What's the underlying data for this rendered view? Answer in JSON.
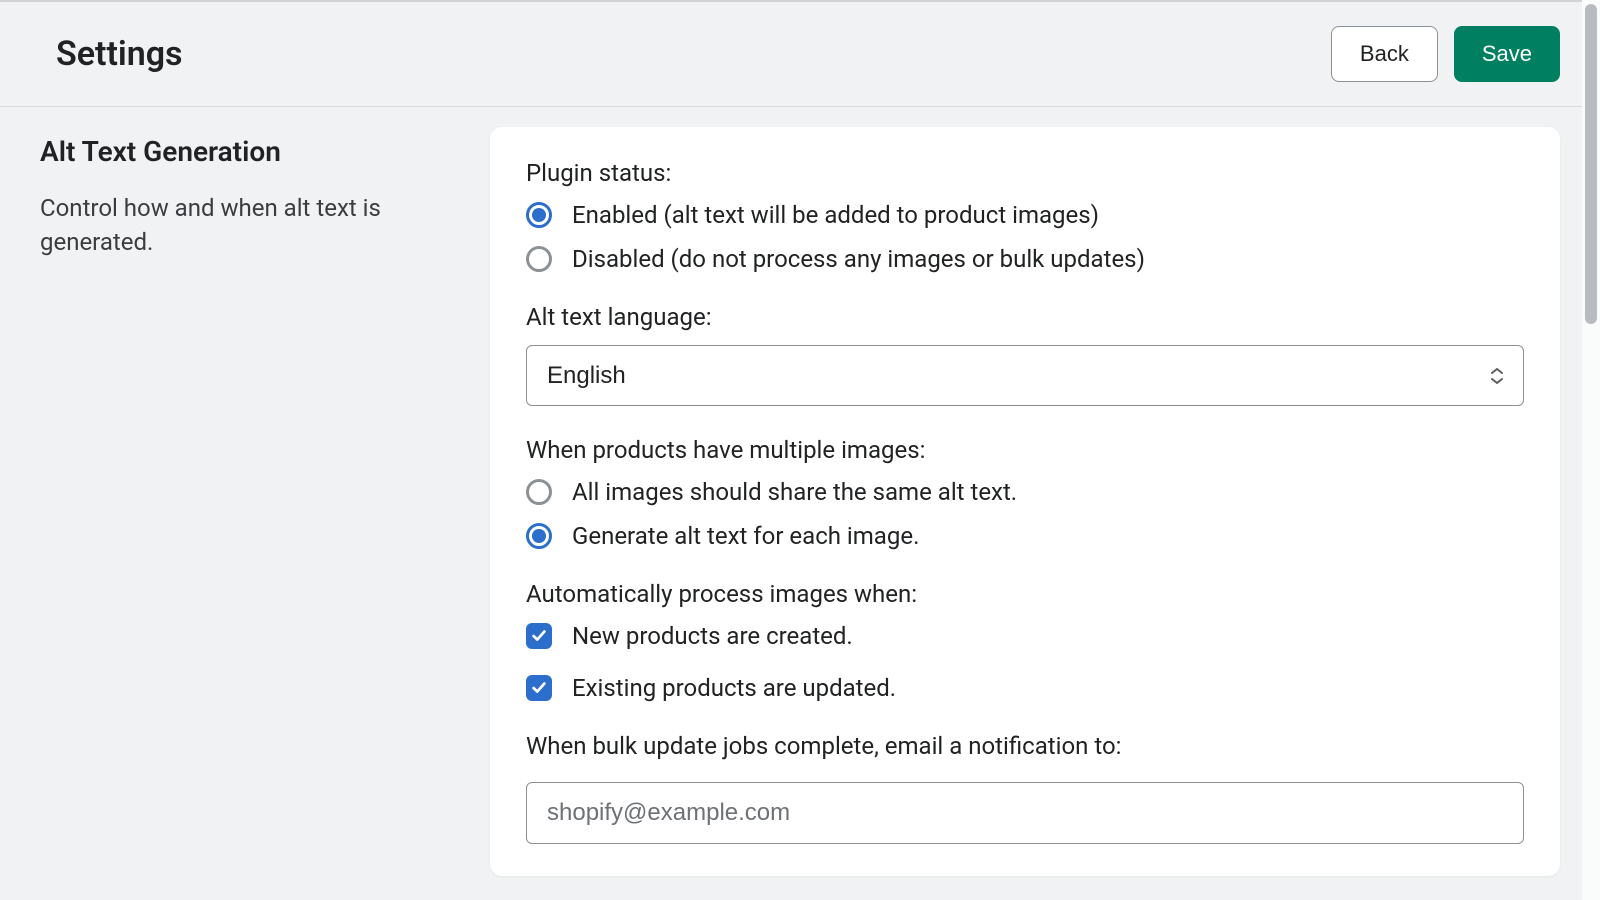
{
  "header": {
    "title": "Settings",
    "back_label": "Back",
    "save_label": "Save"
  },
  "sidebar": {
    "title": "Alt Text Generation",
    "description": "Control how and when alt text is generated."
  },
  "form": {
    "plugin_status": {
      "label": "Plugin status:",
      "selected": "enabled",
      "options": {
        "enabled": "Enabled (alt text will be added to product images)",
        "disabled": "Disabled (do not process any images or bulk updates)"
      }
    },
    "language": {
      "label": "Alt text language:",
      "value": "English"
    },
    "multiple_images": {
      "label": "When products have multiple images:",
      "selected": "each",
      "options": {
        "share": "All images should share the same alt text.",
        "each": "Generate alt text for each image."
      }
    },
    "auto_process": {
      "label": "Automatically process images when:",
      "options": {
        "new_products": {
          "label": "New products are created.",
          "checked": true
        },
        "existing_products": {
          "label": "Existing products are updated.",
          "checked": true
        }
      }
    },
    "notification": {
      "label": "When bulk update jobs complete, email a notification to:",
      "value": "shopify@example.com"
    }
  }
}
